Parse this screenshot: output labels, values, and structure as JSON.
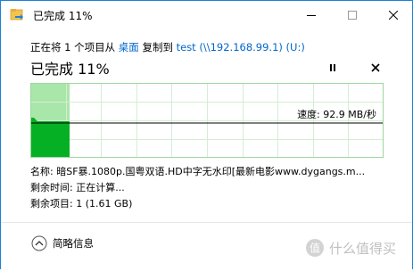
{
  "window": {
    "title": "已完成 11%"
  },
  "copy": {
    "prefix": "正在将 1 个项目从",
    "source": "桌面",
    "middle": "复制到",
    "destination": "test (\\\\192.168.99.1) (U:)"
  },
  "status": {
    "progress_label": "已完成 11%",
    "percent": 11
  },
  "graph": {
    "speed_label": "速度: 92.9 MB/秒",
    "colors": {
      "completed_fill": "#a9e6a9",
      "remaining_fill": "#ffffff",
      "speed_fill": "#06b025",
      "grid": "#d5ecd5",
      "line": "#000000"
    }
  },
  "details": {
    "name_label": "名称:",
    "name_value": "暗SF暴.1080p.国粤双语.HD中字无水印[最新电影www.dygangs.m...",
    "time_label": "剩余时间:",
    "time_value": "正在计算...",
    "items_label": "剩余项目:",
    "items_value": "1 (1.61 GB)"
  },
  "footer": {
    "toggle_label": "简略信息",
    "toggle_icon": "chevron-up-icon"
  },
  "watermark": {
    "text": "值 什么值得买"
  },
  "icons": {
    "minimize": "minimize-icon",
    "maximize": "maximize-icon",
    "close": "close-icon",
    "pause": "pause-icon",
    "cancel": "cancel-icon"
  }
}
